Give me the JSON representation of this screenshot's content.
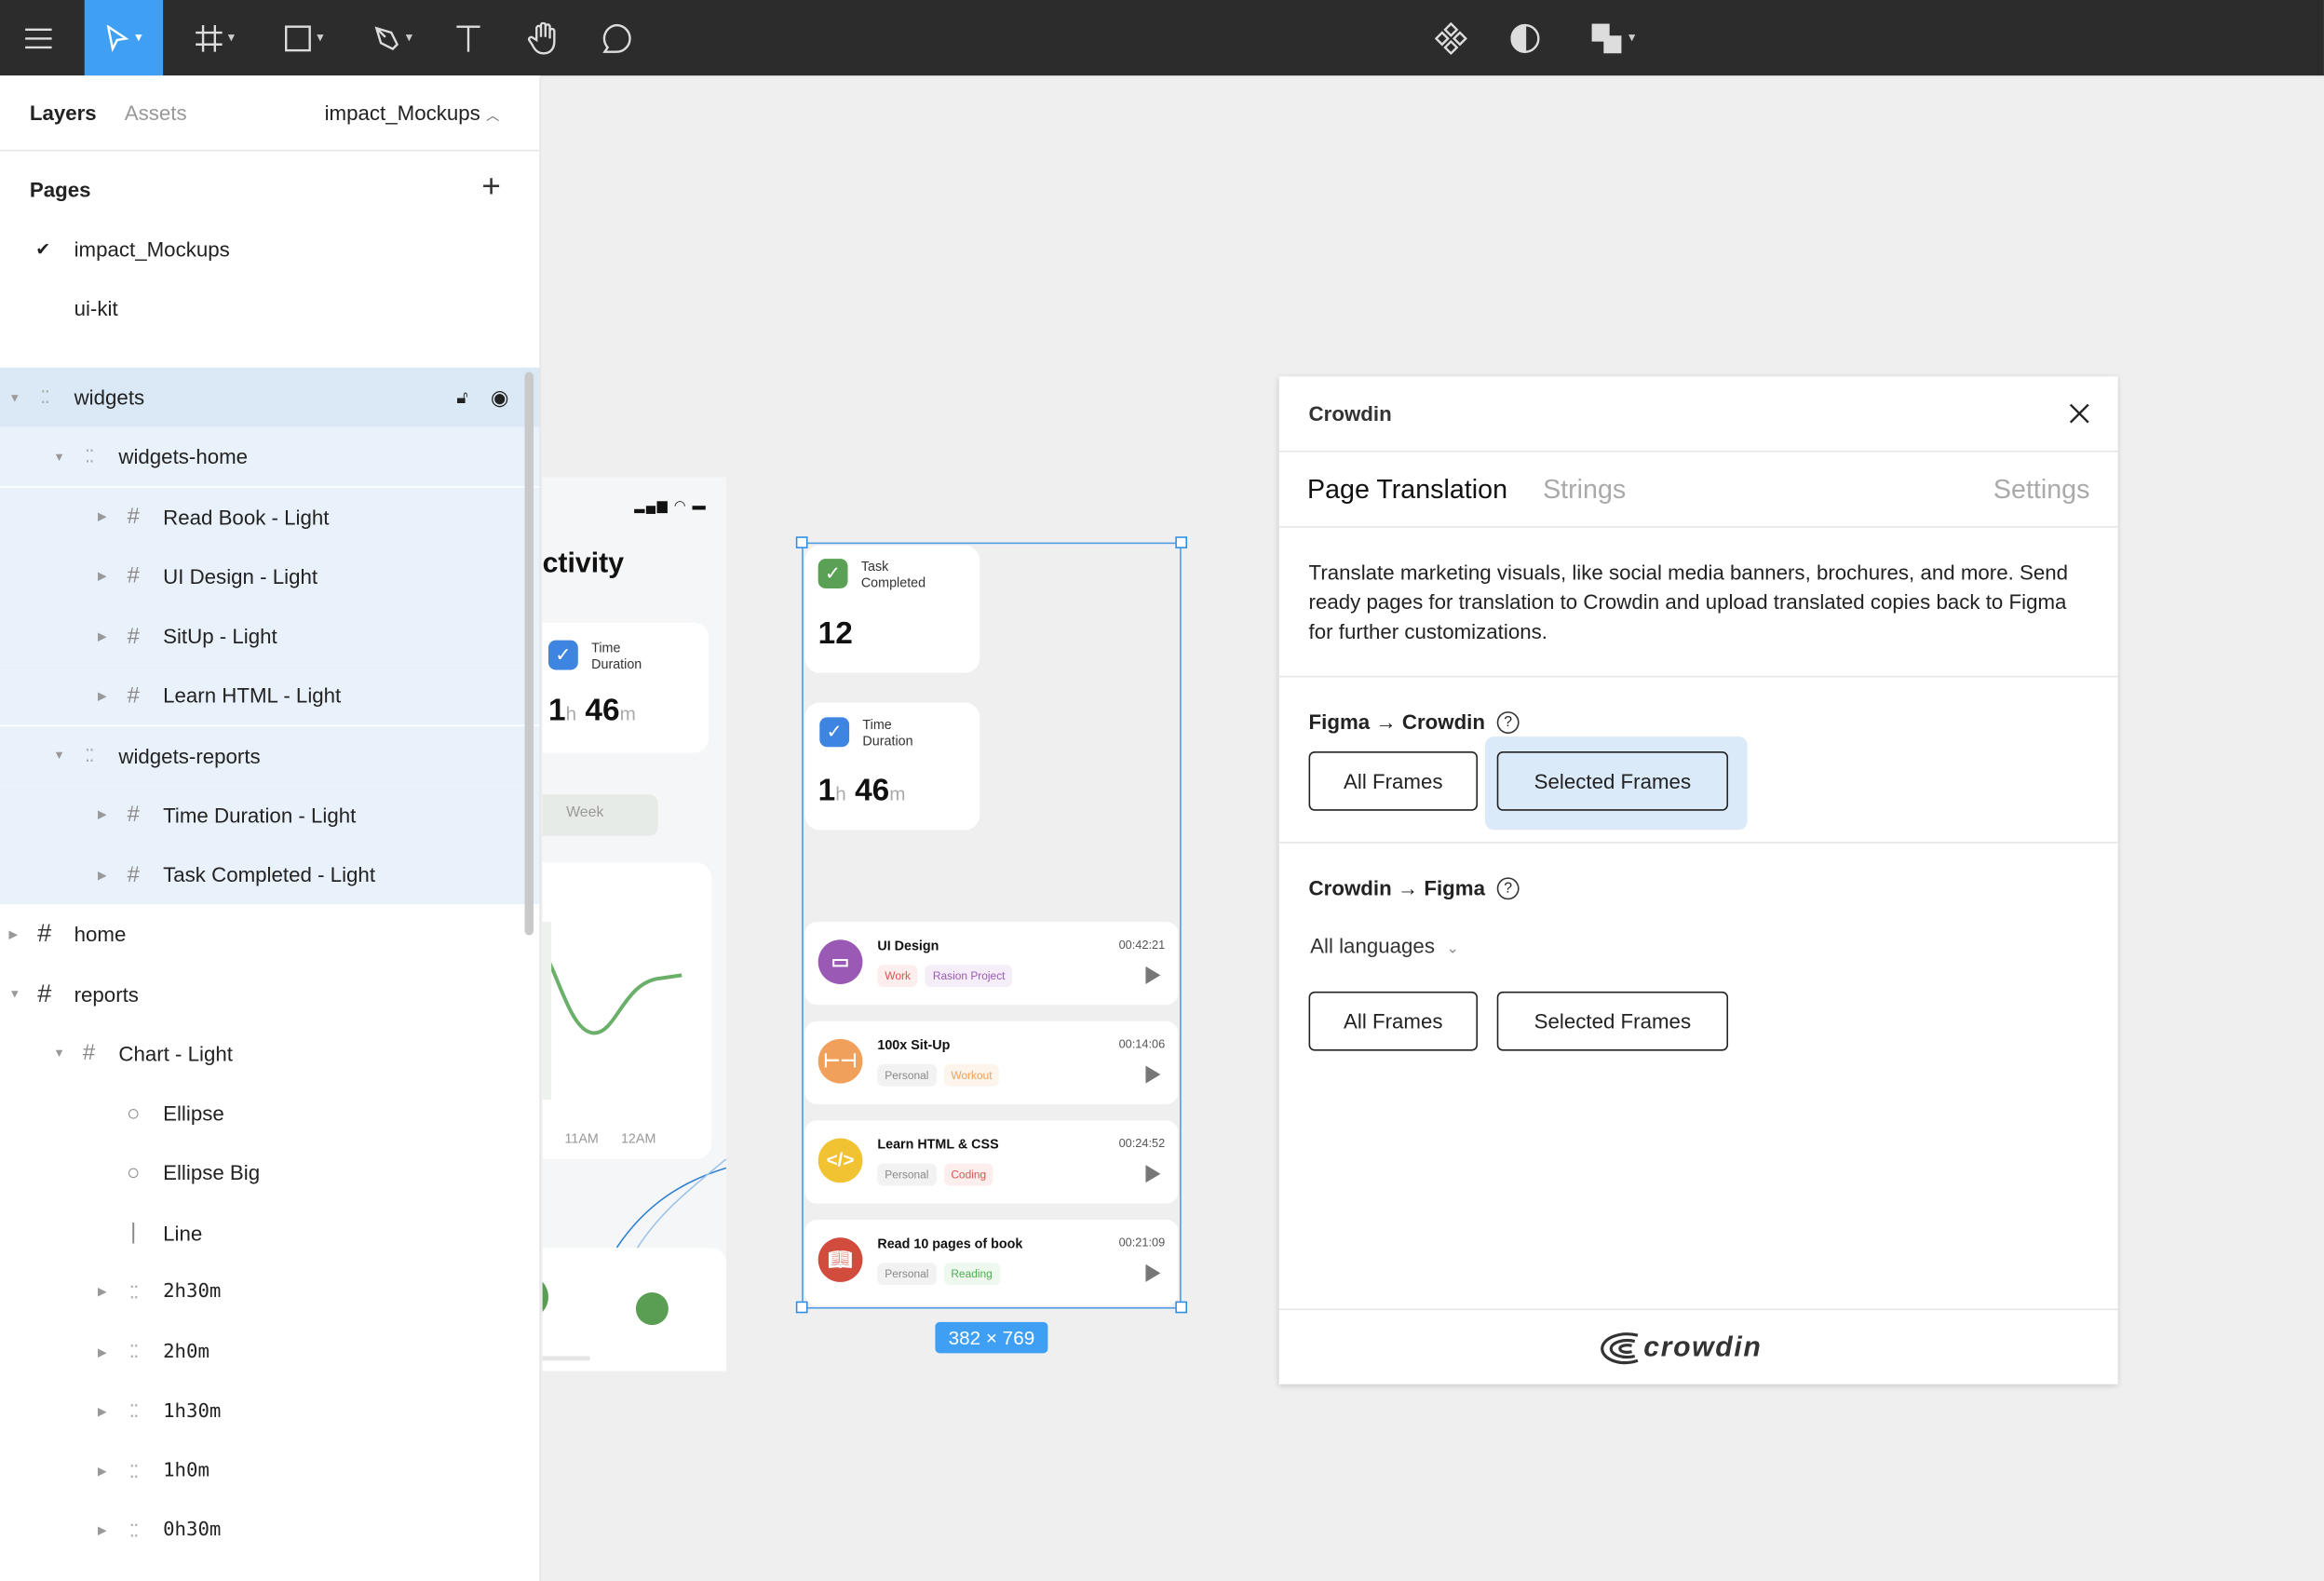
{
  "toolbar": {
    "tools": [
      "main-menu",
      "move",
      "frame",
      "shape",
      "pen",
      "text",
      "hand",
      "comment"
    ],
    "right_tools": [
      "component",
      "mask",
      "boolean"
    ],
    "accent": "#3f9ff3"
  },
  "sidebar": {
    "tab_layers": "Layers",
    "tab_assets": "Assets",
    "file_name": "impact_Mockups",
    "pages_title": "Pages",
    "pages": [
      {
        "label": "impact_Mockups",
        "current": true
      },
      {
        "label": "ui-kit",
        "current": false
      }
    ],
    "layers": [
      {
        "label": "widgets",
        "type": "group",
        "level": 0,
        "expanded": true,
        "selected": true
      },
      {
        "label": "widgets-home",
        "type": "group",
        "level": 1,
        "expanded": true
      },
      {
        "label": "Read Book - Light",
        "type": "frame",
        "level": 2,
        "expanded": false
      },
      {
        "label": "UI Design - Light",
        "type": "frame",
        "level": 2,
        "expanded": false
      },
      {
        "label": "SitUp - Light",
        "type": "frame",
        "level": 2,
        "expanded": false
      },
      {
        "label": "Learn HTML - Light",
        "type": "frame",
        "level": 2,
        "expanded": false
      },
      {
        "label": "widgets-reports",
        "type": "group",
        "level": 1,
        "expanded": true
      },
      {
        "label": "Time Duration - Light",
        "type": "frame",
        "level": 2,
        "expanded": false
      },
      {
        "label": "Task Completed - Light",
        "type": "frame",
        "level": 2,
        "expanded": false
      },
      {
        "label": "home",
        "type": "frame",
        "level": 0,
        "expanded": false
      },
      {
        "label": "reports",
        "type": "frame",
        "level": 0,
        "expanded": true
      },
      {
        "label": "Chart - Light",
        "type": "frame",
        "level": 1,
        "expanded": true
      },
      {
        "label": "Ellipse",
        "type": "ellipse",
        "level": 2
      },
      {
        "label": "Ellipse Big",
        "type": "ellipse",
        "level": 2
      },
      {
        "label": "Line",
        "type": "line",
        "level": 2
      },
      {
        "label": "2h30m",
        "type": "group",
        "level": 2,
        "expanded": false,
        "mono": true
      },
      {
        "label": "2h0m",
        "type": "group",
        "level": 2,
        "expanded": false,
        "mono": true
      },
      {
        "label": "1h30m",
        "type": "group",
        "level": 2,
        "expanded": false,
        "mono": true
      },
      {
        "label": "1h0m",
        "type": "group",
        "level": 2,
        "expanded": false,
        "mono": true
      },
      {
        "label": "0h30m",
        "type": "group",
        "level": 2,
        "expanded": false,
        "mono": true
      }
    ]
  },
  "canvas": {
    "bg_mockup": {
      "title": "ctivity",
      "time_label_1": "Time",
      "time_label_2": "Duration",
      "hours": "1",
      "h": "h",
      "minutes": "46",
      "m": "m",
      "week": "Week",
      "x_ticks": [
        "11AM",
        "12AM"
      ]
    },
    "frame": {
      "size_label": "382 × 769",
      "task_card": {
        "label_1": "Task",
        "label_2": "Completed",
        "value": "12"
      },
      "time_card": {
        "label_1": "Time",
        "label_2": "Duration",
        "hours": "1",
        "h": "h",
        "minutes": "46",
        "m": "m"
      },
      "tasks": [
        {
          "title": "UI Design",
          "time": "00:42:21",
          "color": "#9b59b6",
          "icon": "monitor-icon",
          "tags": [
            {
              "label": "Work",
              "color": "#d9534f",
              "bg": "#fdeeee"
            },
            {
              "label": "Rasion Project",
              "color": "#9b59b6",
              "bg": "#f5eef9"
            }
          ]
        },
        {
          "title": "100x Sit-Up",
          "time": "00:14:06",
          "color": "#f0a05a",
          "icon": "dumbbell-icon",
          "tags": [
            {
              "label": "Personal",
              "color": "#888",
              "bg": "#f2f2f2"
            },
            {
              "label": "Workout",
              "color": "#f0a05a",
              "bg": "#fdf4ec"
            }
          ]
        },
        {
          "title": "Learn HTML & CSS",
          "time": "00:24:52",
          "color": "#f1c232",
          "icon": "code-icon",
          "tags": [
            {
              "label": "Personal",
              "color": "#888",
              "bg": "#f2f2f2"
            },
            {
              "label": "Coding",
              "color": "#d9534f",
              "bg": "#fdeeee"
            }
          ]
        },
        {
          "title": "Read 10 pages of book",
          "time": "00:21:09",
          "color": "#d24c3e",
          "icon": "book-icon",
          "tags": [
            {
              "label": "Personal",
              "color": "#888",
              "bg": "#f2f2f2"
            },
            {
              "label": "Reading",
              "color": "#4caf50",
              "bg": "#eef8ee"
            }
          ]
        }
      ]
    }
  },
  "crowdin": {
    "title": "Crowdin",
    "tabs": [
      "Page Translation",
      "Strings",
      "Settings"
    ],
    "active_tab": "Page Translation",
    "description": "Translate marketing visuals, like social media banners, brochures, and more. Send ready pages for translation to Crowdin and upload translated copies back to Figma for further customizations.",
    "upload_title": "Figma → Crowdin",
    "upload_buttons": [
      "All Frames",
      "Selected Frames"
    ],
    "upload_selected": "Selected Frames",
    "download_title": "Crowdin → Figma",
    "language_select": "All languages",
    "download_buttons": [
      "All Frames",
      "Selected Frames"
    ],
    "logo_text": "crowdin"
  }
}
